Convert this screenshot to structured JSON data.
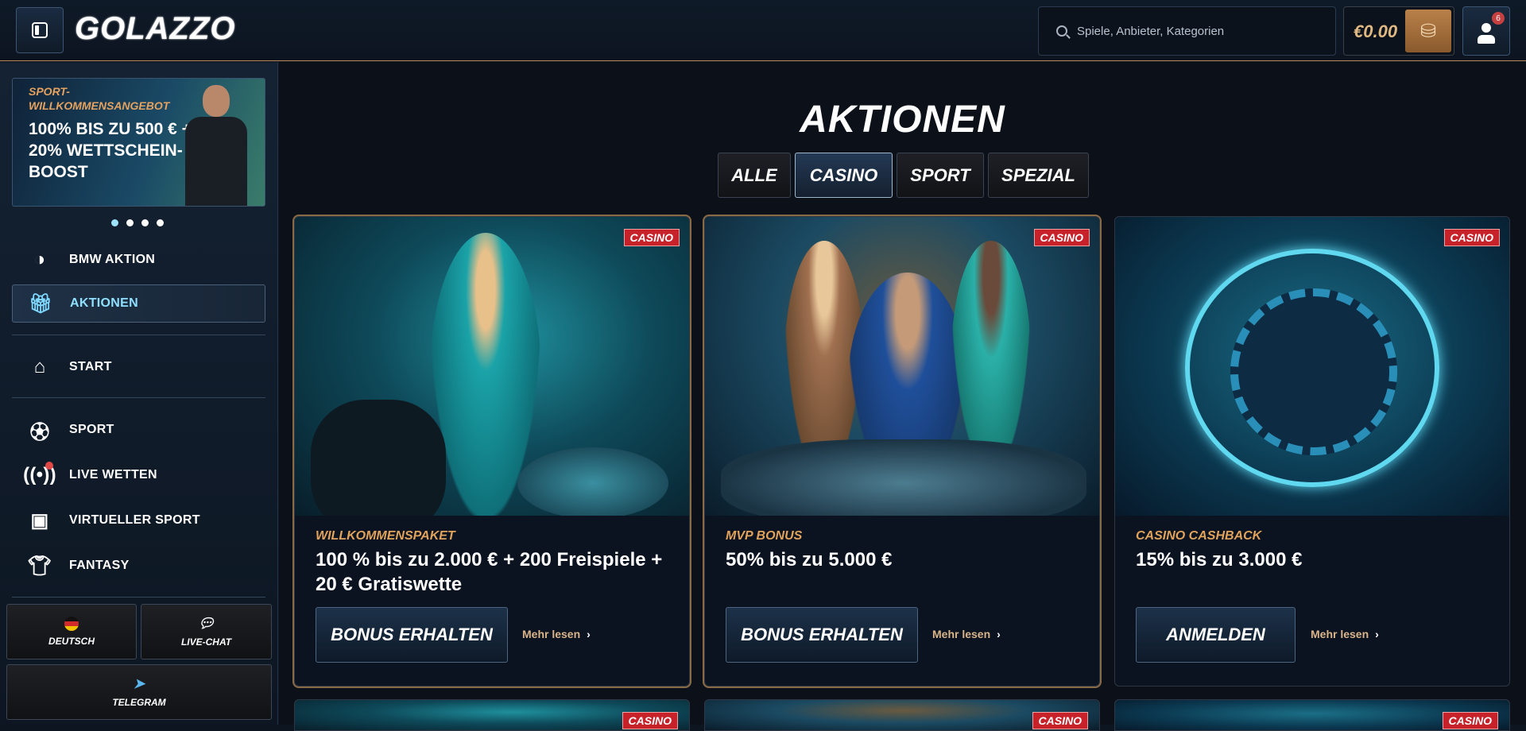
{
  "header": {
    "logo_text": "GOLAZZO",
    "search_placeholder": "Spiele, Anbieter, Kategorien",
    "balance": "€0.00",
    "notification_count": "6"
  },
  "sidebar": {
    "promo": {
      "subtitle": "SPORT-WILLKOMMENSANGEBOT",
      "title": "100% BIS ZU 500 € + 20% WETTSCHEIN-BOOST"
    },
    "carousel_dots": 4,
    "items": [
      {
        "label": "BMW AKTION",
        "icon": "bmw-icon"
      },
      {
        "label": "AKTIONEN",
        "icon": "gift-icon",
        "active": true
      },
      {
        "label": "START",
        "icon": "home-icon"
      },
      {
        "label": "SPORT",
        "icon": "soccer-ball-icon"
      },
      {
        "label": "LIVE WETTEN",
        "icon": "live-broadcast-icon"
      },
      {
        "label": "VIRTUELLER SPORT",
        "icon": "virtual-screen-icon"
      },
      {
        "label": "FANTASY",
        "icon": "jersey-icon"
      }
    ],
    "bottom": {
      "language": "DEUTSCH",
      "chat": "LIVE-CHAT",
      "telegram": "TELEGRAM"
    }
  },
  "main": {
    "title": "AKTIONEN",
    "tabs": [
      {
        "label": "ALLE"
      },
      {
        "label": "CASINO",
        "active": true
      },
      {
        "label": "SPORT"
      },
      {
        "label": "SPEZIAL"
      }
    ],
    "cards": [
      {
        "badge": "CASINO",
        "label": "WILLKOMMENSPAKET",
        "title": "100 % bis zu 2.000 € + 200 Freispiele + 20 € Gratiswette",
        "cta": "BONUS ERHALTEN",
        "more": "Mehr lesen"
      },
      {
        "badge": "CASINO",
        "label": "MVP BONUS",
        "title": "50% bis zu 5.000 €",
        "cta": "BONUS ERHALTEN",
        "more": "Mehr lesen"
      },
      {
        "badge": "CASINO",
        "label": "CASINO CASHBACK",
        "title": "15% bis zu 3.000 €",
        "cta": "ANMELDEN",
        "more": "Mehr lesen"
      }
    ],
    "next_row_badges": [
      "CASINO",
      "CASINO",
      "CASINO"
    ]
  },
  "colors": {
    "accent_orange": "#e1a35c",
    "accent_cyan": "#8fe0ff",
    "badge_red": "#c7212a"
  }
}
